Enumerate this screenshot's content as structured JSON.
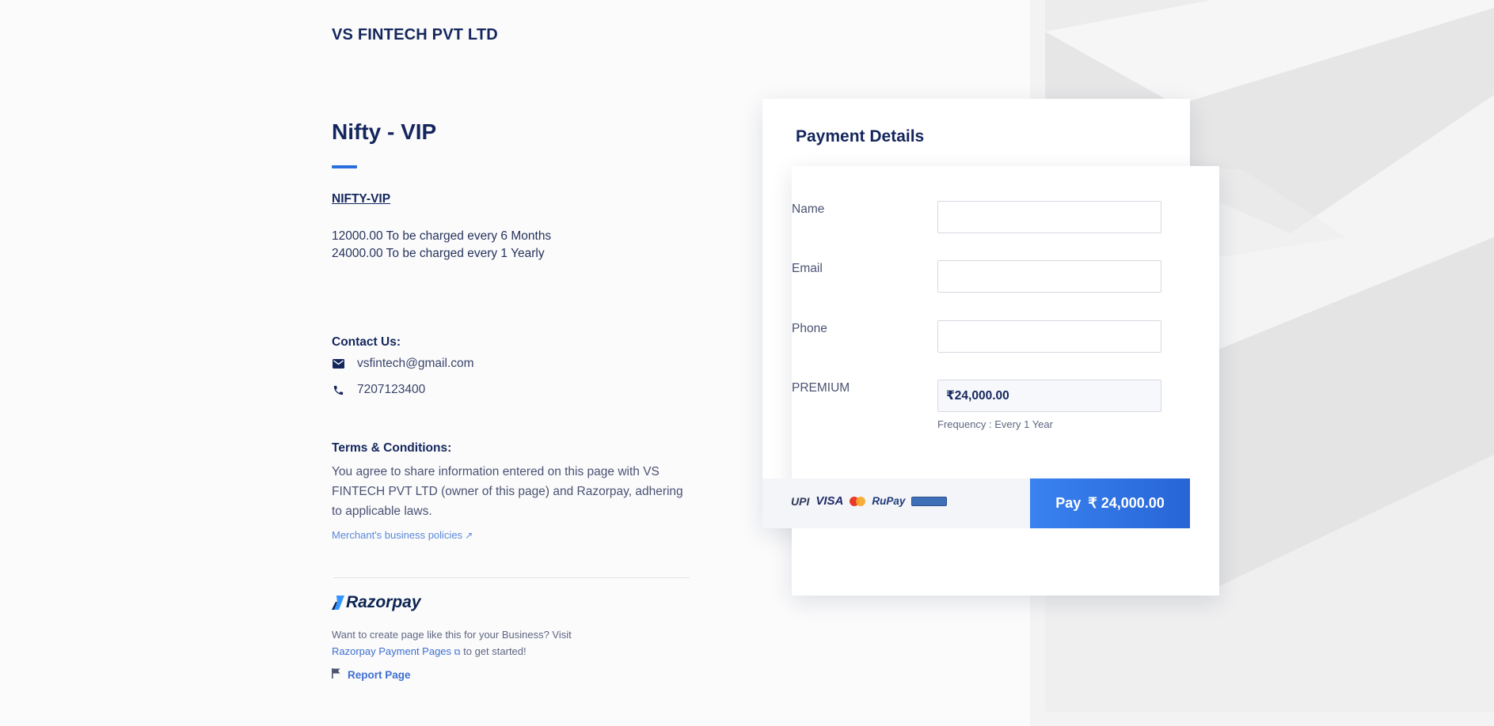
{
  "company": {
    "name": "VS FINTECH PVT LTD"
  },
  "page": {
    "title": "Nifty - VIP",
    "code_link": "NIFTY-VIP",
    "charges": [
      "12000.00 To be charged every 6 Months",
      "24000.00 To be charged every 1 Yearly"
    ]
  },
  "contact": {
    "title": "Contact Us:",
    "email": "vsfintech@gmail.com",
    "phone": "7207123400",
    "email_icon": "mail-icon",
    "phone_icon": "phone-icon"
  },
  "terms": {
    "title": "Terms & Conditions:",
    "text": "You agree to share information entered on this page with VS FINTECH PVT LTD (owner of this page) and Razorpay, adhering to applicable laws.",
    "policies_link": "Merchant's business policies"
  },
  "footer": {
    "brand": "Razorpay",
    "create_text": "Want to create page like this for your Business? Visit",
    "create_link": "Razorpay Payment Pages",
    "create_suffix": "to get started!",
    "report": "Report Page"
  },
  "payment": {
    "title": "Payment Details",
    "fields": {
      "name_label": "Name",
      "name_value": "",
      "email_label": "Email",
      "email_value": "",
      "phone_label": "Phone",
      "phone_value": ""
    },
    "premium_label": "PREMIUM",
    "currency_symbol": "₹",
    "premium_value": "24,000.00",
    "frequency": "Frequency : Every 1 Year",
    "methods": [
      "UPI",
      "VISA",
      "Mastercard",
      "RuPay",
      "card"
    ],
    "pay_label": "Pay",
    "pay_amount": "₹ 24,000.00"
  },
  "colors": {
    "accent": "#2b6fde",
    "primary_text": "#14265c",
    "pay_button": "#2f74e6"
  }
}
